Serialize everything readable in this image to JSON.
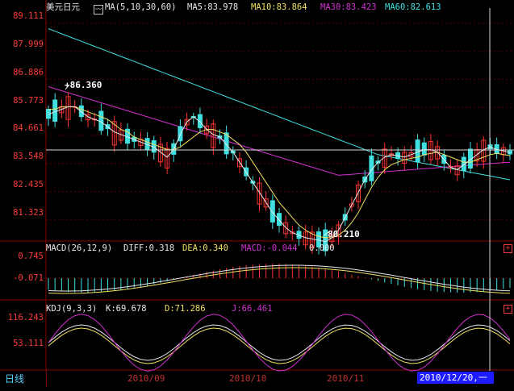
{
  "window": {
    "symbol_name": "美元日元",
    "timeframe_tab": "日线"
  },
  "colors": {
    "background": "#000000",
    "frame": "#8b0000",
    "axis_text": "#ff3a3a",
    "candle_up": "#ff3333",
    "candle_down": "#40e0e0",
    "ma5": "#e8e8e8",
    "ma10": "#f0e060",
    "ma30": "#d030d0",
    "ma60": "#40e0e0",
    "macd_dea": "#f0e060",
    "macd_diff": "#e8e8e8",
    "cursor_date_bg": "#1c1cff"
  },
  "main_panel": {
    "legend": {
      "ma_params": "MA(5,10,30,60)",
      "ma5": "MA5:83.978",
      "ma10": "MA10:83.864",
      "ma30": "MA30:83.423",
      "ma60": "MA60:82.613"
    },
    "y_ticks": [
      "89.111",
      "87.999",
      "86.886",
      "85.773",
      "84.661",
      "83.548",
      "82.435",
      "81.323"
    ],
    "y_range": [
      80.5,
      89.4
    ],
    "high_marker": "86.360",
    "low_marker": "80.210"
  },
  "macd_panel": {
    "legend": {
      "params": "MACD(26,12,9)",
      "diff": "DIFF:0.318",
      "dea": "DEA:0.340",
      "macd": "MACD:-0.044",
      "extra": "0.000"
    },
    "y_ticks": [
      "0.745",
      "-0.071"
    ]
  },
  "kdj_panel": {
    "legend": {
      "params": "KDJ(9,3,3)",
      "k": "K:69.678",
      "d": "D:71.286",
      "j": "J:66.461"
    },
    "y_ticks": [
      "116.243",
      "53.111"
    ]
  },
  "date_axis": {
    "labels": [
      "2010/09",
      "2010/10",
      "2010/11"
    ],
    "cursor_date": "2010/12/20,一"
  },
  "chart_data": {
    "type": "candlestick",
    "series": [
      {
        "name": "MA5",
        "values": [
          85.5,
          85.6,
          85.7,
          85.8,
          85.8,
          85.6,
          85.4,
          85.3,
          85.2,
          85.0,
          84.8,
          84.7,
          84.6,
          84.5,
          84.4,
          84.3,
          84.2,
          84.0,
          83.8,
          84.1,
          84.7,
          85.2,
          85.4,
          85.2,
          84.9,
          84.7,
          84.6,
          84.3,
          84.0,
          83.6,
          83.2,
          82.8,
          82.4,
          82.0,
          81.6,
          81.3,
          81.0,
          80.8,
          80.7,
          80.6,
          80.55,
          80.5,
          80.45,
          80.6,
          80.9,
          81.4,
          81.9,
          82.4,
          82.9,
          83.3,
          83.6,
          83.8,
          83.9,
          83.85,
          83.8,
          83.9,
          84.0,
          84.1,
          84.1,
          84.0,
          83.7,
          83.4,
          83.3,
          83.5,
          83.7,
          83.9,
          84.1,
          84.2,
          84.1,
          84.05,
          83.98
        ]
      },
      {
        "name": "MA10",
        "values": [
          85.7,
          85.7,
          85.8,
          85.8,
          85.8,
          85.7,
          85.6,
          85.5,
          85.4,
          85.3,
          85.1,
          84.9,
          84.8,
          84.6,
          84.5,
          84.4,
          84.3,
          84.2,
          84.1,
          84.1,
          84.2,
          84.4,
          84.6,
          84.8,
          84.9,
          84.9,
          84.8,
          84.7,
          84.5,
          84.3,
          84.0,
          83.6,
          83.2,
          82.8,
          82.4,
          82.0,
          81.7,
          81.4,
          81.1,
          80.9,
          80.75,
          80.65,
          80.6,
          80.6,
          80.7,
          80.9,
          81.2,
          81.6,
          82.1,
          82.6,
          83.0,
          83.3,
          83.5,
          83.6,
          83.7,
          83.75,
          83.8,
          83.9,
          83.95,
          84.0,
          83.9,
          83.8,
          83.7,
          83.6,
          83.6,
          83.7,
          83.8,
          83.9,
          83.95,
          83.9,
          83.86
        ]
      }
    ]
  }
}
